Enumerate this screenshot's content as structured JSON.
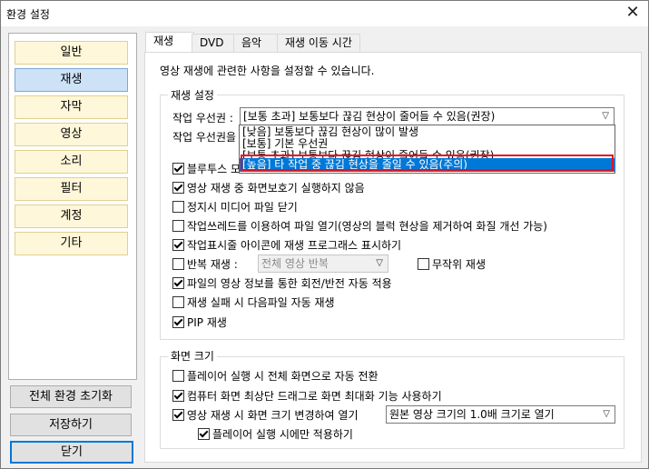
{
  "window": {
    "title": "환경 설정",
    "close_glyph": "✕"
  },
  "sidebar": {
    "categories": [
      {
        "label": "일반",
        "selected": false
      },
      {
        "label": "재생",
        "selected": true
      },
      {
        "label": "자막",
        "selected": false
      },
      {
        "label": "영상",
        "selected": false
      },
      {
        "label": "소리",
        "selected": false
      },
      {
        "label": "필터",
        "selected": false
      },
      {
        "label": "계정",
        "selected": false
      },
      {
        "label": "기타",
        "selected": false
      }
    ],
    "reset_button": "전체 환경 초기화",
    "save_button": "저장하기",
    "close_button": "닫기"
  },
  "tabs": [
    {
      "label": "재생",
      "active": true
    },
    {
      "label": "DVD",
      "active": false
    },
    {
      "label": "음악",
      "active": false
    },
    {
      "label": "재생 이동 시간",
      "active": false
    }
  ],
  "panel": {
    "description": "영상 재생에 관련한 사항을 설정할 수 있습니다.",
    "playback_group": {
      "title": "재생 설정",
      "priority_label": "작업 우선권 :",
      "priority_value": "[보통 초과] 보통보다 끊김 현상이 줄어들 수 있음(권장)",
      "priority_label2": "작업 우선권을",
      "dropdown_options": [
        "[낮음] 보통보다 끊김 현상이 많이 발생",
        "[보통] 기본 우선권",
        "[보통 초과] 보통보다 끊김 현상이 줄어들 수 있음(권장)",
        "[높음] 타 작업 중 끊김 현상을 줄일 수 있음(주의)"
      ],
      "highlighted_option": 3,
      "bluetooth_label": "블루투스 모",
      "checkboxes": [
        {
          "label": "영상 재생 중 화면보호기 실행하지 않음",
          "checked": true
        },
        {
          "label": "정지시 미디어 파일 닫기",
          "checked": false
        },
        {
          "label": "작업쓰레드를 이용하여 파일 열기(영상의 블럭 현상을 제거하여 화질 개선 가능)",
          "checked": false
        },
        {
          "label": "작업표시줄 아이콘에 재생 프로그래스 표시하기",
          "checked": true
        }
      ],
      "repeat_label": "반복 재생 :",
      "repeat_checked": false,
      "repeat_value": "전체 영상 반복",
      "shuffle_label": "무작위 재생",
      "shuffle_checked": false,
      "more_checkboxes": [
        {
          "label": "파일의 영상 정보를 통한 회전/반전 자동 적용",
          "checked": true
        },
        {
          "label": "재생 실패 시 다음파일 자동 재생",
          "checked": false
        },
        {
          "label": "PIP 재생",
          "checked": true
        }
      ]
    },
    "screen_group": {
      "title": "화면 크기",
      "checkboxes": [
        {
          "label": "플레이어 실행 시 전체 화면으로 자동 전환",
          "checked": false
        },
        {
          "label": "컴퓨터 화면 최상단 드래그로 화면 최대화 기능 사용하기",
          "checked": true
        }
      ],
      "resize_label": "영상 재생 시 화면 크기 변경하여 열기",
      "resize_checked": true,
      "resize_value": "원본 영상 크기의 1.0배 크기로 열기",
      "only_on_launch_label": "플레이어 실행 시에만 적용하기",
      "only_on_launch_checked": true
    }
  }
}
